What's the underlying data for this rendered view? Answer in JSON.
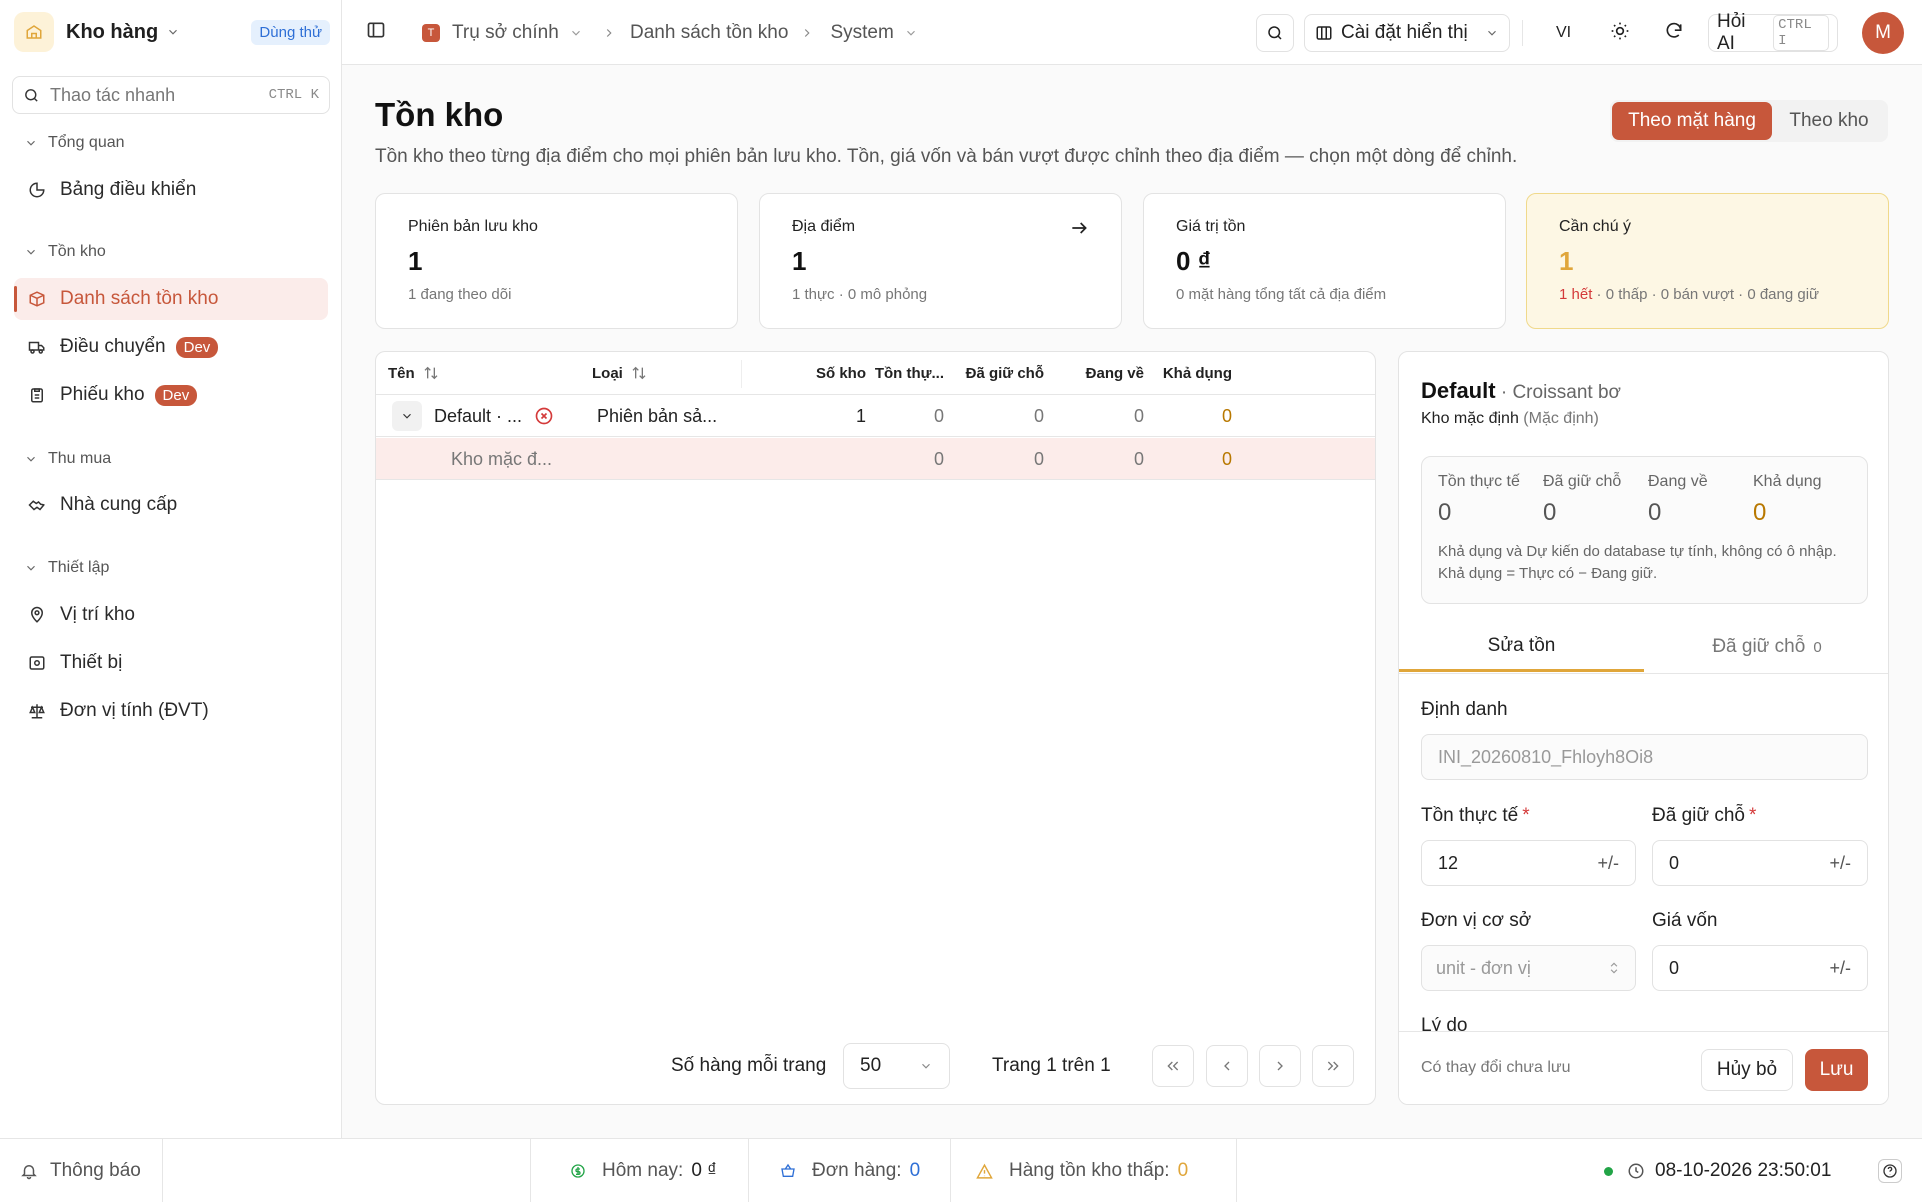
{
  "sidebar": {
    "brand": "Kho hàng",
    "trial_badge": "Dùng thử",
    "search_placeholder": "Thao tác nhanh",
    "search_shortcut": "CTRL K",
    "groups": {
      "overview": "Tổng quan",
      "inventory": "Tồn kho",
      "purchasing": "Thu mua",
      "setup": "Thiết lập"
    },
    "items": {
      "dashboard": "Bảng điều khiển",
      "stock_list": "Danh sách tồn kho",
      "transfer": "Điều chuyển",
      "stock_slip": "Phiếu kho",
      "suppliers": "Nhà cung cấp",
      "locations": "Vị trí kho",
      "devices": "Thiết bị",
      "uom": "Đơn vị tính (ĐVT)"
    },
    "dev_badge": "Dev"
  },
  "topbar": {
    "org_initial": "T",
    "org": "Trụ sở chính",
    "crumb_page": "Danh sách tồn kho",
    "crumb_system": "System",
    "display_settings": "Cài đặt hiển thị",
    "lang": "VI",
    "ask_ai": "Hỏi AI",
    "ask_ai_shortcut": "CTRL I",
    "avatar": "M"
  },
  "page": {
    "title": "Tồn kho",
    "subtitle": "Tồn kho theo từng địa điểm cho mọi phiên bản lưu kho. Tồn, giá vốn và bán vượt được chỉnh theo địa điểm — chọn một dòng để chỉnh.",
    "view_by_item": "Theo mặt hàng",
    "view_by_warehouse": "Theo kho"
  },
  "cards": {
    "variants": {
      "label": "Phiên bản lưu kho",
      "value": "1",
      "sub": "1 đang theo dõi"
    },
    "locations": {
      "label": "Địa điểm",
      "value": "1",
      "sub": "1 thực · 0 mô phỏng"
    },
    "stock_value": {
      "label": "Giá trị tồn",
      "value": "0 ₫",
      "sub": "0 mặt hàng tổng tất cả địa điểm"
    },
    "attention": {
      "label": "Cần chú ý",
      "value": "1",
      "sub_out": "1 hết",
      "sub_rest": " · 0 thấp · 0 bán vượt · 0 đang giữ"
    }
  },
  "table": {
    "headers": {
      "name": "Tên",
      "type": "Loại",
      "warehouses": "Số kho",
      "on_hand": "Tồn thự...",
      "reserved": "Đã giữ chỗ",
      "incoming": "Đang về",
      "available": "Khả dụng"
    },
    "rows": [
      {
        "name": "Default · ...",
        "type": "Phiên bản sả...",
        "warehouses": "1",
        "on_hand": "0",
        "reserved": "0",
        "incoming": "0",
        "available": "0"
      }
    ],
    "subrows": [
      {
        "name": "Kho mặc đ...",
        "on_hand": "0",
        "reserved": "0",
        "incoming": "0",
        "available": "0"
      }
    ],
    "rows_per_page_label": "Số hàng mỗi trang",
    "rows_per_page": "50",
    "page_info": "Trang 1 trên 1"
  },
  "detail": {
    "title": "Default",
    "title_sep": " · ",
    "product": "Croissant bơ",
    "warehouse": "Kho mặc định",
    "warehouse_default": "(Mặc định)",
    "stats": {
      "on_hand_label": "Tồn thực tế",
      "on_hand": "0",
      "reserved_label": "Đã giữ chỗ",
      "reserved": "0",
      "incoming_label": "Đang về",
      "incoming": "0",
      "available_label": "Khả dụng",
      "available": "0"
    },
    "stats_note": "Khả dụng và Dự kiến do database tự tính, không có ô nhập. Khả dụng = Thực có − Đang giữ.",
    "tab_edit": "Sửa tồn",
    "tab_reserved": "Đã giữ chỗ",
    "tab_reserved_count": "0",
    "form": {
      "identifier_label": "Định danh",
      "identifier": "INI_20260810_Fhloyh8Oi8",
      "on_hand_label": "Tồn thực tế",
      "on_hand": "12",
      "reserved_label": "Đã giữ chỗ",
      "reserved": "0",
      "base_unit_label": "Đơn vị cơ sở",
      "base_unit": "unit - đơn vị",
      "cost_label": "Giá vốn",
      "cost": "0",
      "reason_label": "Lý do",
      "stepper": "+/-",
      "required_mark": "*"
    },
    "unsaved": "Có thay đổi chưa lưu",
    "cancel": "Hủy bỏ",
    "save": "Lưu"
  },
  "statusbar": {
    "notifications": "Thông báo",
    "today_label": "Hôm nay:",
    "today": "0 ₫",
    "orders_label": "Đơn hàng:",
    "orders": "0",
    "low_stock_label": "Hàng tồn kho thấp:",
    "low_stock": "0",
    "datetime": "08-10-2026 23:50:01"
  },
  "colors": {
    "accent": "#c7573b",
    "amber": "#b87800",
    "danger": "#d43a3a",
    "online": "#22a447"
  }
}
